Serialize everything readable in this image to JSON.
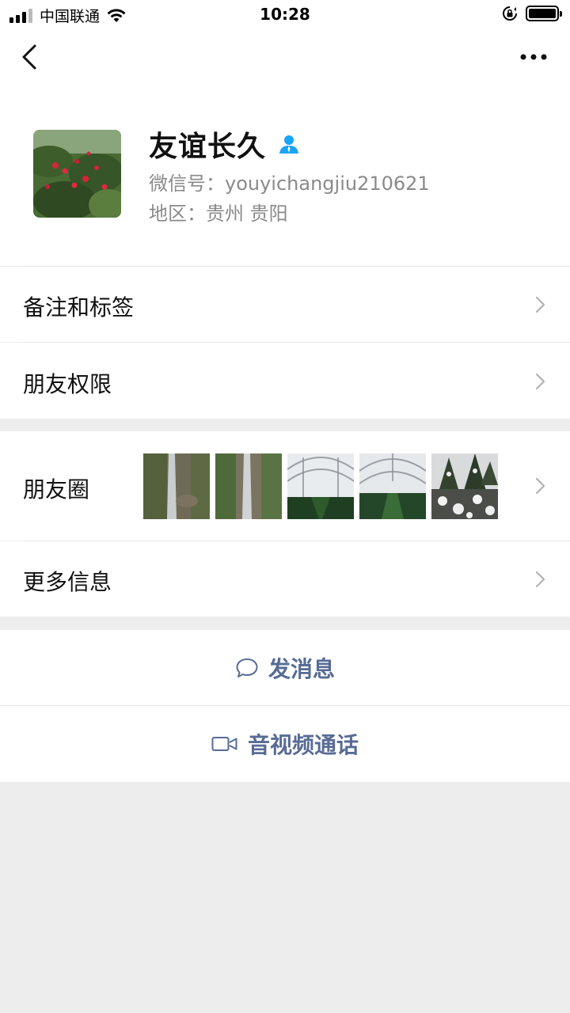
{
  "status_bar": {
    "carrier": "中国联通",
    "time": "10:28"
  },
  "icons": {
    "back": "chevron-left-icon",
    "more": "more-dots-icon",
    "contact": "person-icon",
    "chevron": "chevron-right-icon",
    "message": "chat-bubble-icon",
    "video": "video-camera-icon"
  },
  "profile": {
    "nickname": "友谊长久",
    "wechat_id": "微信号：youyichangjiu210621",
    "region": "地区：贵州 贵阳"
  },
  "menu": {
    "remarks_tags": "备注和标签",
    "friend_permissions": "朋友权限",
    "moments": "朋友圈",
    "more_info": "更多信息"
  },
  "actions": {
    "send_message": "发消息",
    "voice_video_call": "音视频通话"
  },
  "colors": {
    "link_blue": "#576b95",
    "badge_blue": "#1aa4f5",
    "page_gray": "#ededed"
  }
}
